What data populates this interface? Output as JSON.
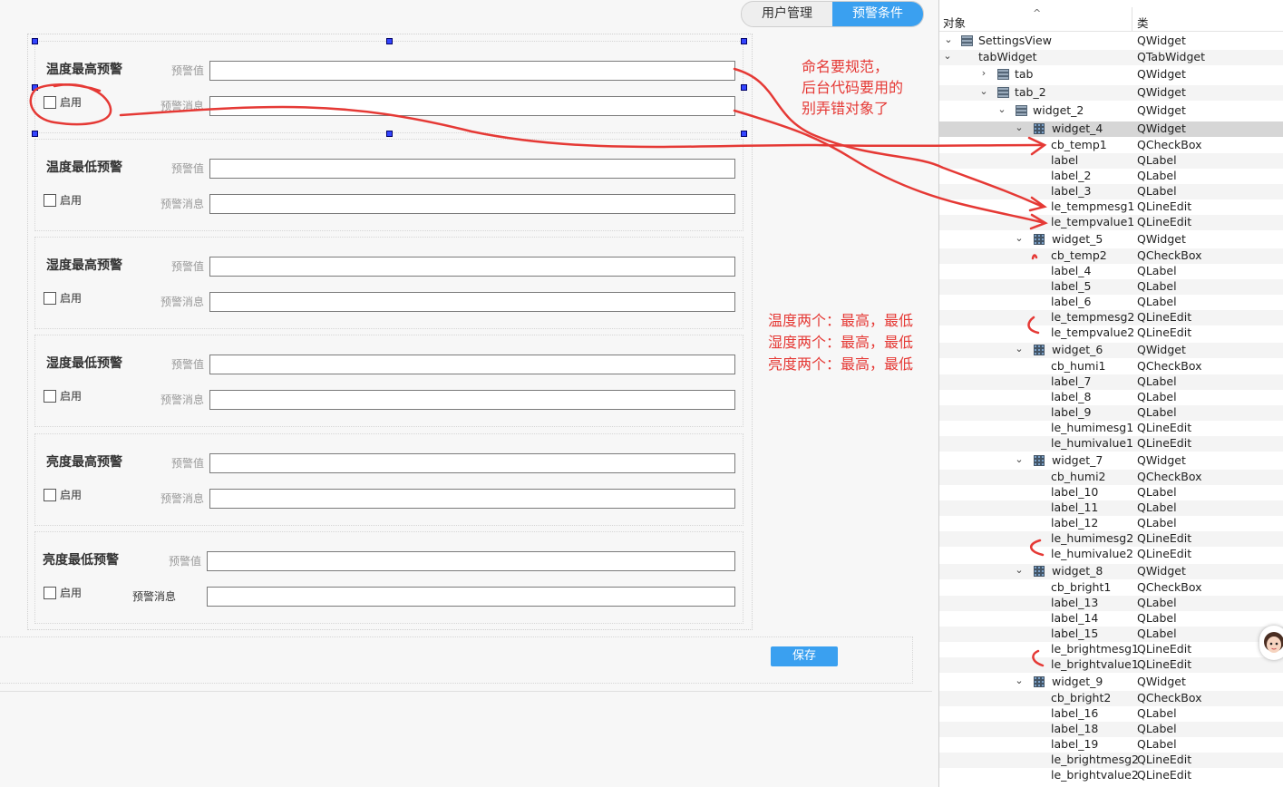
{
  "tabs": {
    "user_mgmt": "用户管理",
    "alert_cond": "预警条件"
  },
  "groups": [
    {
      "title": "温度最高预警",
      "value_label": "预警值",
      "msg_label": "预警消息",
      "enable_label": "启用"
    },
    {
      "title": "温度最低预警",
      "value_label": "预警值",
      "msg_label": "预警消息",
      "enable_label": "启用"
    },
    {
      "title": "湿度最高预警",
      "value_label": "预警值",
      "msg_label": "预警消息",
      "enable_label": "启用"
    },
    {
      "title": "湿度最低预警",
      "value_label": "预警值",
      "msg_label": "预警消息",
      "enable_label": "启用"
    },
    {
      "title": "亮度最高预警",
      "value_label": "预警值",
      "msg_label": "预警消息",
      "enable_label": "启用"
    },
    {
      "title": "亮度最低预警",
      "value_label": "预警值",
      "msg_label": "预警消息",
      "enable_label": "启用"
    }
  ],
  "save_label": "保存",
  "tree": {
    "header": {
      "object": "对象",
      "class": "类"
    },
    "rows": [
      {
        "name": "SettingsView",
        "cls": "QWidget"
      },
      {
        "name": "tabWidget",
        "cls": "QTabWidget"
      },
      {
        "name": "tab",
        "cls": "QWidget"
      },
      {
        "name": "tab_2",
        "cls": "QWidget"
      },
      {
        "name": "widget_2",
        "cls": "QWidget"
      },
      {
        "name": "widget_4",
        "cls": "QWidget"
      },
      {
        "name": "cb_temp1",
        "cls": "QCheckBox"
      },
      {
        "name": "label",
        "cls": "QLabel"
      },
      {
        "name": "label_2",
        "cls": "QLabel"
      },
      {
        "name": "label_3",
        "cls": "QLabel"
      },
      {
        "name": "le_tempmesg1",
        "cls": "QLineEdit"
      },
      {
        "name": "le_tempvalue1",
        "cls": "QLineEdit"
      },
      {
        "name": "widget_5",
        "cls": "QWidget"
      },
      {
        "name": "cb_temp2",
        "cls": "QCheckBox"
      },
      {
        "name": "label_4",
        "cls": "QLabel"
      },
      {
        "name": "label_5",
        "cls": "QLabel"
      },
      {
        "name": "label_6",
        "cls": "QLabel"
      },
      {
        "name": "le_tempmesg2",
        "cls": "QLineEdit"
      },
      {
        "name": "le_tempvalue2",
        "cls": "QLineEdit"
      },
      {
        "name": "widget_6",
        "cls": "QWidget"
      },
      {
        "name": "cb_humi1",
        "cls": "QCheckBox"
      },
      {
        "name": "label_7",
        "cls": "QLabel"
      },
      {
        "name": "label_8",
        "cls": "QLabel"
      },
      {
        "name": "label_9",
        "cls": "QLabel"
      },
      {
        "name": "le_humimesg1",
        "cls": "QLineEdit"
      },
      {
        "name": "le_humivalue1",
        "cls": "QLineEdit"
      },
      {
        "name": "widget_7",
        "cls": "QWidget"
      },
      {
        "name": "cb_humi2",
        "cls": "QCheckBox"
      },
      {
        "name": "label_10",
        "cls": "QLabel"
      },
      {
        "name": "label_11",
        "cls": "QLabel"
      },
      {
        "name": "label_12",
        "cls": "QLabel"
      },
      {
        "name": "le_humimesg2",
        "cls": "QLineEdit"
      },
      {
        "name": "le_humivalue2",
        "cls": "QLineEdit"
      },
      {
        "name": "widget_8",
        "cls": "QWidget"
      },
      {
        "name": "cb_bright1",
        "cls": "QCheckBox"
      },
      {
        "name": "label_13",
        "cls": "QLabel"
      },
      {
        "name": "label_14",
        "cls": "QLabel"
      },
      {
        "name": "label_15",
        "cls": "QLabel"
      },
      {
        "name": "le_brightmesg1",
        "cls": "QLineEdit"
      },
      {
        "name": "le_brightvalue1",
        "cls": "QLineEdit"
      },
      {
        "name": "widget_9",
        "cls": "QWidget"
      },
      {
        "name": "cb_bright2",
        "cls": "QCheckBox"
      },
      {
        "name": "label_16",
        "cls": "QLabel"
      },
      {
        "name": "label_18",
        "cls": "QLabel"
      },
      {
        "name": "label_19",
        "cls": "QLabel"
      },
      {
        "name": "le_brightmesg2",
        "cls": "QLineEdit"
      },
      {
        "name": "le_brightvalue2",
        "cls": "QLineEdit"
      }
    ]
  },
  "notes": {
    "naming": [
      "命名要规范，",
      "后台代码要用的",
      "别弄错对象了"
    ],
    "counts": [
      "温度两个：最高，最低",
      "湿度两个：最高，最低",
      "亮度两个：最高，最低"
    ]
  },
  "colors": {
    "accent": "#3aa0f0",
    "annotation": "#e53935"
  }
}
